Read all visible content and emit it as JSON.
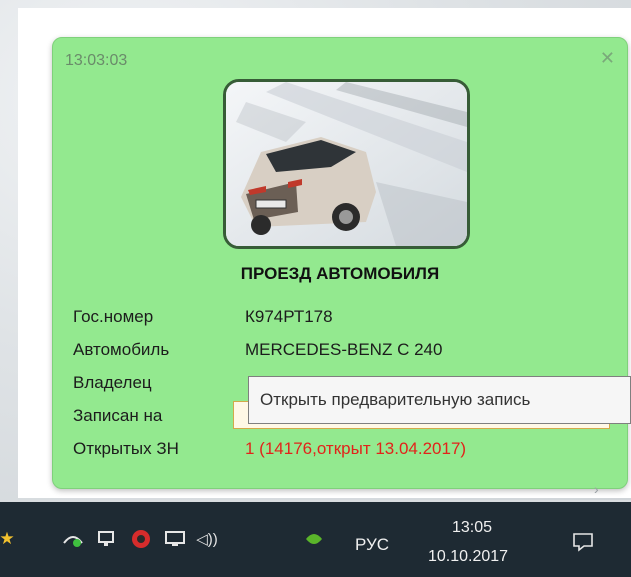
{
  "popup": {
    "time": "13:03:03",
    "title": "ПРОЕЗД АВТОМОБИЛЯ",
    "fields": [
      {
        "label": "Гос.номер",
        "value": "К974РТ178"
      },
      {
        "label": "Автомобиль",
        "value": "MERCEDES-BENZ C 240"
      },
      {
        "label": "Владелец",
        "value": ""
      },
      {
        "label": "Записан на",
        "value": ""
      },
      {
        "label": "Открытых ЗН",
        "value": "1 (14176,открыт 13.04.2017)"
      }
    ],
    "close_icon": "close-icon",
    "background_color": "#93e98f",
    "alert_color": "#e2231a"
  },
  "tooltip": {
    "text": "Открыть предварительную запись"
  },
  "taskbar": {
    "language": "РУС",
    "time": "13:05",
    "date": "10.10.2017",
    "icons": [
      "star-icon",
      "network-sync-icon",
      "network-monitor-icon",
      "record-icon",
      "display-icon",
      "volume-icon",
      "app-tray-icon",
      "notification-icon"
    ]
  }
}
